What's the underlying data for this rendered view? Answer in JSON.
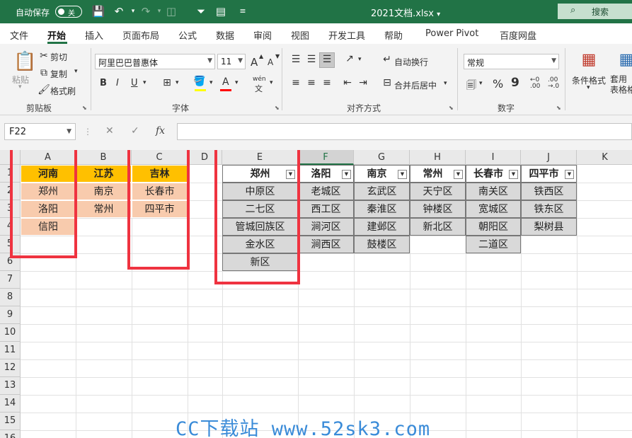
{
  "titlebar": {
    "autosave_label": "自动保存",
    "autosave_state": "关",
    "filename": "2021文档.xlsx",
    "filename_caret": "▾",
    "search_label": "搜索"
  },
  "tabs": [
    "文件",
    "开始",
    "插入",
    "页面布局",
    "公式",
    "数据",
    "审阅",
    "视图",
    "开发工具",
    "帮助",
    "Power Pivot",
    "百度网盘"
  ],
  "ribbon": {
    "clipboard": {
      "paste": "粘贴",
      "cut": "剪切",
      "copy": "复制",
      "format_painter": "格式刷",
      "group": "剪贴板"
    },
    "font": {
      "name": "阿里巴巴普惠体",
      "size": "11",
      "group": "字体",
      "bold": "B",
      "italic": "I",
      "underline": "U",
      "increase": "A",
      "decrease": "A",
      "phonetic": "wén"
    },
    "alignment": {
      "wrap": "自动换行",
      "merge": "合并后居中",
      "group": "对齐方式"
    },
    "number": {
      "format": "常规",
      "group": "数字",
      "percent": "%",
      "comma": "9"
    },
    "styles": {
      "conditional": "条件格式",
      "table": "套用\n表格格"
    }
  },
  "formula_bar": {
    "namebox": "F22",
    "fx": "fx",
    "value": ""
  },
  "columns": [
    "A",
    "B",
    "C",
    "D",
    "E",
    "F",
    "G",
    "H",
    "I",
    "J",
    "K"
  ],
  "rows": [
    "1",
    "2",
    "3",
    "4",
    "5",
    "6",
    "7",
    "8",
    "9",
    "10",
    "11",
    "12",
    "13",
    "14",
    "15",
    "16"
  ],
  "sheet": {
    "provinces": [
      "河南",
      "江苏",
      "吉林"
    ],
    "henan": [
      "郑州",
      "洛阳",
      "信阳"
    ],
    "jiangsu": [
      "南京",
      "常州"
    ],
    "jilin": [
      "长春市",
      "四平市"
    ],
    "table_headers": [
      "郑州",
      "洛阳",
      "南京",
      "常州",
      "长春市",
      "四平市"
    ],
    "zhengzhou": [
      "中原区",
      "二七区",
      "管城回族区",
      "金水区",
      "新区"
    ],
    "luoyang": [
      "老城区",
      "西工区",
      "涧河区",
      "涧西区"
    ],
    "nanjing": [
      "玄武区",
      "秦淮区",
      "建邺区",
      "鼓楼区"
    ],
    "changzhou": [
      "天宁区",
      "钟楼区",
      "新北区"
    ],
    "changchun": [
      "南关区",
      "宽城区",
      "朝阳区",
      "二道区"
    ],
    "siping": [
      "铁西区",
      "铁东区",
      "梨树县"
    ]
  },
  "watermark": "CC下载站 www.52sk3.com",
  "colors": {
    "excel_green": "#217346",
    "header_orange": "#ffc000",
    "peach": "#f8cbad",
    "gray": "#d9d9d9",
    "highlight_red": "#ef3340"
  }
}
